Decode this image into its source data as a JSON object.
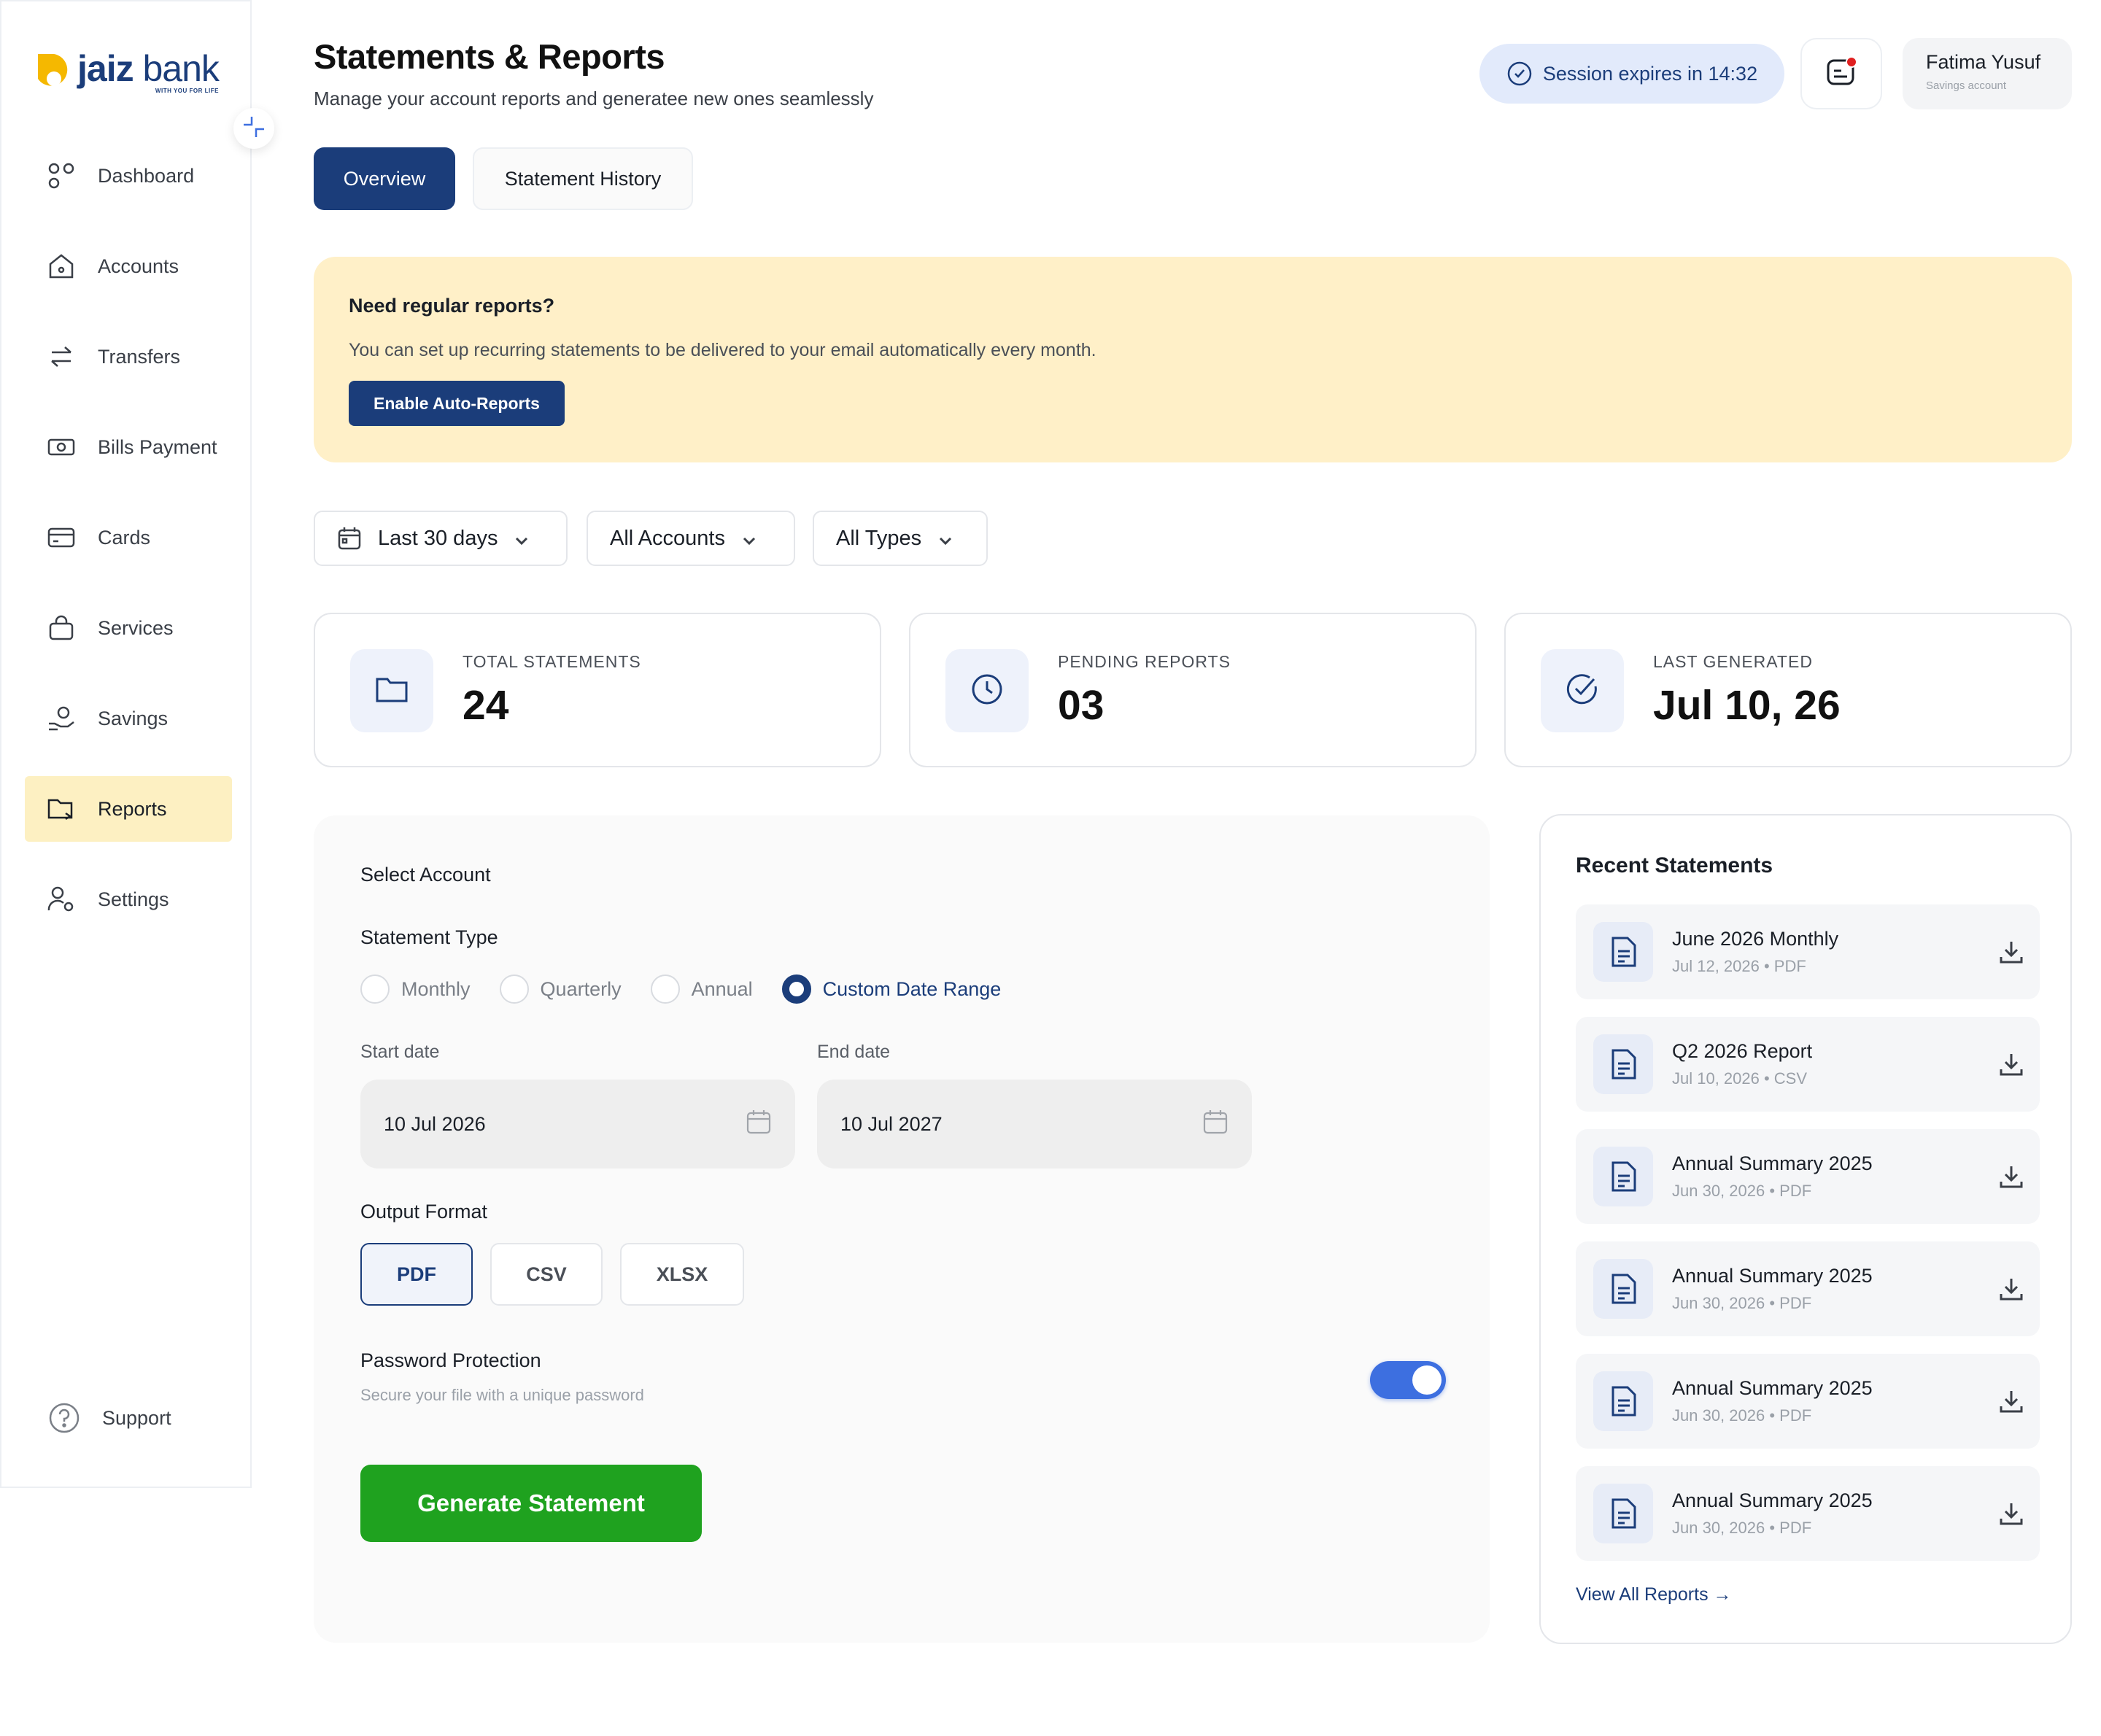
{
  "brand": {
    "name_part1": "jaiz",
    "name_part2": "bank",
    "tagline": "WITH YOU FOR LIFE"
  },
  "sidebar": {
    "items": [
      {
        "label": "Dashboard",
        "icon": "dashboard-icon"
      },
      {
        "label": "Accounts",
        "icon": "home-icon"
      },
      {
        "label": "Transfers",
        "icon": "transfer-arrows-icon"
      },
      {
        "label": "Bills Payment",
        "icon": "money-bill-icon"
      },
      {
        "label": "Cards",
        "icon": "card-icon"
      },
      {
        "label": "Services",
        "icon": "bag-icon"
      },
      {
        "label": "Savings",
        "icon": "savings-hand-icon"
      },
      {
        "label": "Reports",
        "icon": "folder-icon",
        "active": true
      },
      {
        "label": "Settings",
        "icon": "user-gear-icon"
      }
    ],
    "support_label": "Support"
  },
  "header": {
    "title": "Statements & Reports",
    "subtitle": "Manage your account reports and generatee new ones seamlessly",
    "session_text": "Session expires in 14:32",
    "user_name": "Fatima Yusuf",
    "user_role": "Savings account"
  },
  "tabs": [
    {
      "label": "Overview",
      "active": true
    },
    {
      "label": "Statement History",
      "active": false
    }
  ],
  "banner": {
    "title": "Need regular reports?",
    "text": "You can set up recurring statements to be delivered to your email automatically every month.",
    "button": "Enable Auto-Reports"
  },
  "filters": {
    "date_range": "Last 30 days",
    "accounts": "All Accounts",
    "types": "All Types"
  },
  "stats": [
    {
      "label": "TOTAL STATEMENTS",
      "value": "24",
      "icon": "folder-icon"
    },
    {
      "label": "PENDING REPORTS",
      "value": "03",
      "icon": "clock-icon"
    },
    {
      "label": "LAST GENERATED",
      "value": "Jul 10, 26",
      "icon": "check-circle-icon"
    }
  ],
  "form": {
    "select_account_label": "Select Account",
    "statement_type_label": "Statement Type",
    "statement_types": [
      "Monthly",
      "Quarterly",
      "Annual",
      "Custom Date Range"
    ],
    "selected_type": "Custom Date Range",
    "start_date_label": "Start date",
    "start_date": "10 Jul 2026",
    "end_date_label": "End date",
    "end_date": "10 Jul 2027",
    "output_format_label": "Output Format",
    "formats": [
      "PDF",
      "CSV",
      "XLSX"
    ],
    "selected_format": "PDF",
    "password_title": "Password Protection",
    "password_sub": "Secure your file with a unique password",
    "password_enabled": true,
    "generate_button": "Generate Statement"
  },
  "recent": {
    "title": "Recent Statements",
    "items": [
      {
        "title": "June 2026 Monthly",
        "meta": "Jul 12, 2026 • PDF"
      },
      {
        "title": "Q2 2026 Report",
        "meta": "Jul 10, 2026 • CSV"
      },
      {
        "title": "Annual Summary 2025",
        "meta": "Jun 30, 2026 • PDF"
      },
      {
        "title": "Annual Summary 2025",
        "meta": "Jun 30, 2026 • PDF"
      },
      {
        "title": "Annual Summary 2025",
        "meta": "Jun 30, 2026 • PDF"
      },
      {
        "title": "Annual Summary 2025",
        "meta": "Jun 30, 2026 • PDF"
      }
    ],
    "view_all": "View All Reports →"
  },
  "colors": {
    "primary": "#1b3d7a",
    "accent_yellow": "#f5b800",
    "banner_bg": "#fff0c8",
    "active_nav": "#fdf0c2",
    "success": "#1fa21f",
    "toggle": "#3d6fe0"
  }
}
